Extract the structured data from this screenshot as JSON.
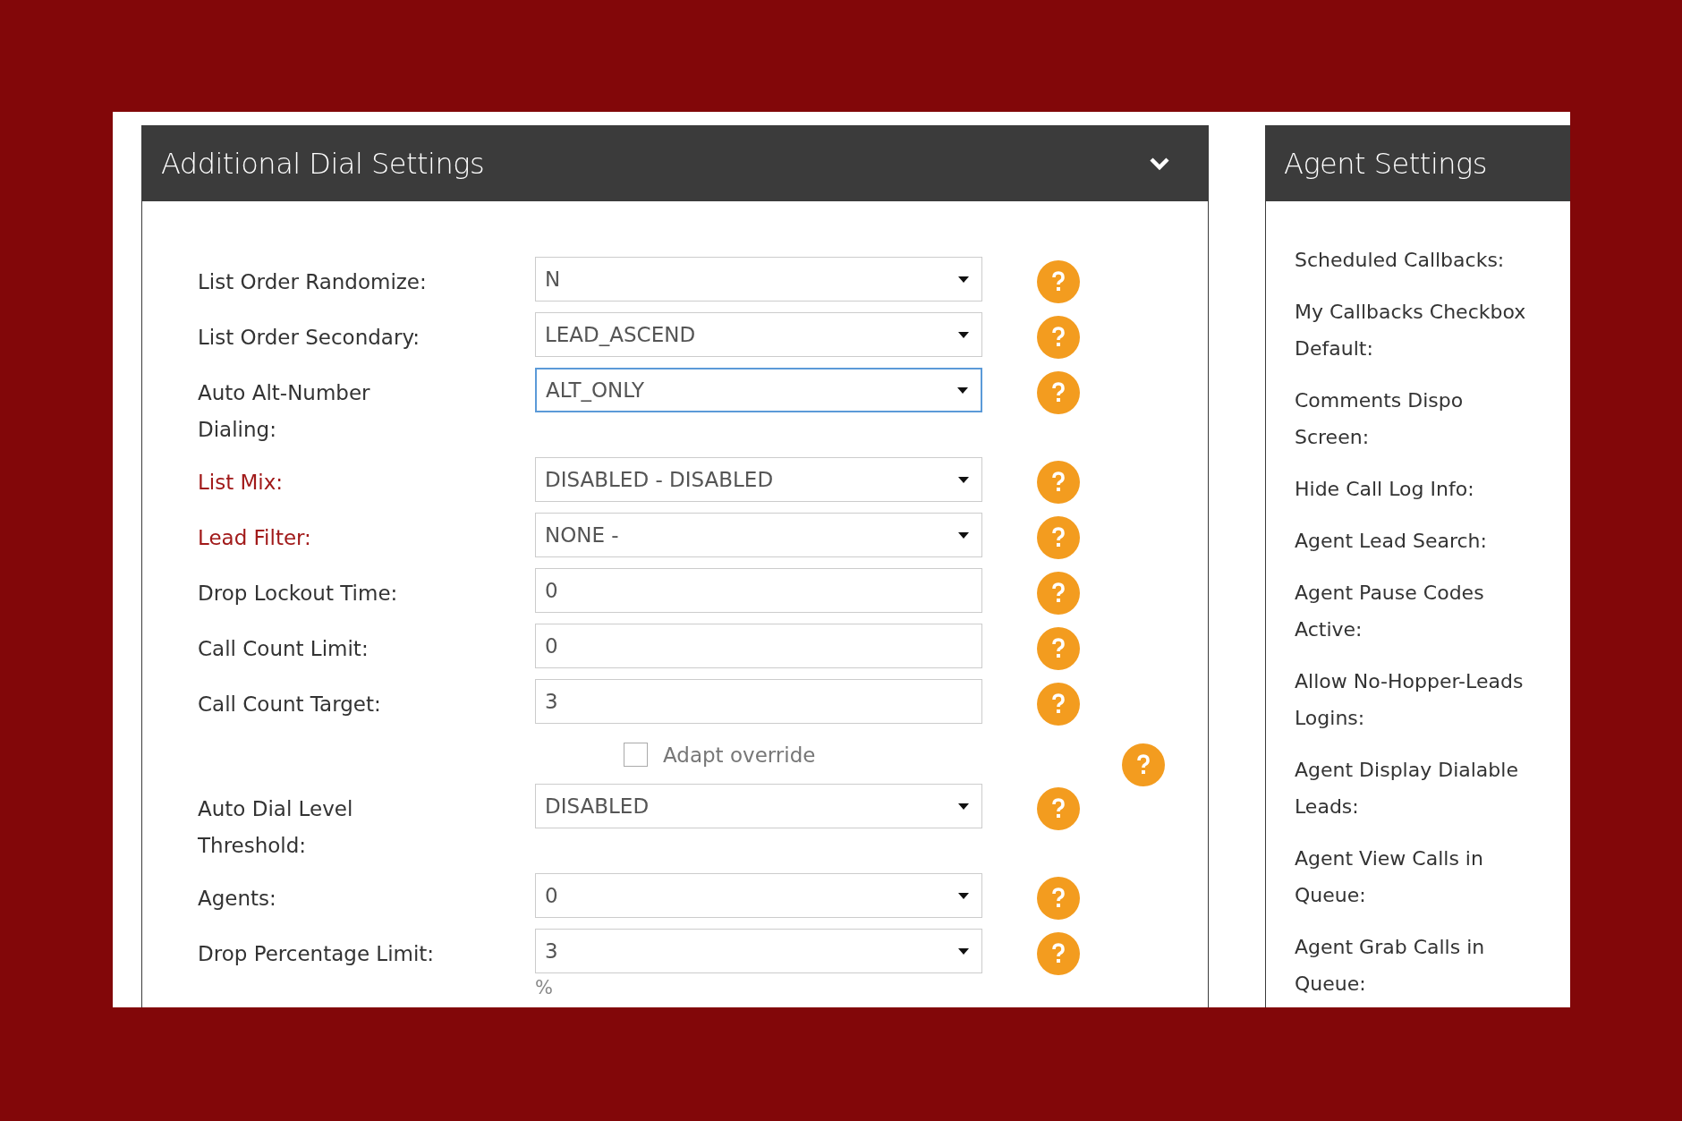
{
  "panels": [
    {
      "title": "Additional Dial Settings",
      "fields": [
        {
          "kind": "select",
          "label": "List Order Randomize:",
          "link": false,
          "value": "N",
          "focused": false
        },
        {
          "kind": "select",
          "label": "List Order Secondary:",
          "link": false,
          "value": "LEAD_ASCEND",
          "focused": false
        },
        {
          "kind": "select",
          "label": "Auto Alt-Number Dialing:",
          "link": false,
          "value": "ALT_ONLY",
          "focused": true
        },
        {
          "kind": "select",
          "label": "List Mix:",
          "link": true,
          "value": "DISABLED - DISABLED",
          "focused": false
        },
        {
          "kind": "select",
          "label": "Lead Filter:",
          "link": true,
          "value": "NONE -",
          "focused": false
        },
        {
          "kind": "text",
          "label": "Drop Lockout Time:",
          "link": false,
          "value": "0",
          "focused": false
        },
        {
          "kind": "text",
          "label": "Call Count Limit:",
          "link": false,
          "value": "0",
          "focused": false
        },
        {
          "kind": "text",
          "label": "Call Count Target:",
          "link": false,
          "value": "3",
          "focused": false
        },
        {
          "kind": "checkbox",
          "label": "Adapt override",
          "checked": false
        },
        {
          "kind": "select",
          "label": "Auto Dial Level Threshold:",
          "link": false,
          "value": "DISABLED",
          "focused": false
        },
        {
          "kind": "select",
          "label": "Agents:",
          "link": false,
          "value": "0",
          "focused": false
        },
        {
          "kind": "select",
          "label": "Drop Percentage Limit:",
          "link": false,
          "value": "3",
          "focused": false,
          "unit": "%"
        }
      ]
    },
    {
      "title": "Agent Settings",
      "labels": [
        "Scheduled Callbacks:",
        "My Callbacks Checkbox Default:",
        "Comments Dispo Screen:",
        "Hide Call Log Info:",
        "Agent Lead Search:",
        "Agent Pause Codes Active:",
        "Allow No-Hopper-Leads Logins:",
        "Agent Display Dialable Leads:",
        "Agent View Calls in Queue:",
        "Agent Grab Calls in Queue:"
      ]
    }
  ]
}
